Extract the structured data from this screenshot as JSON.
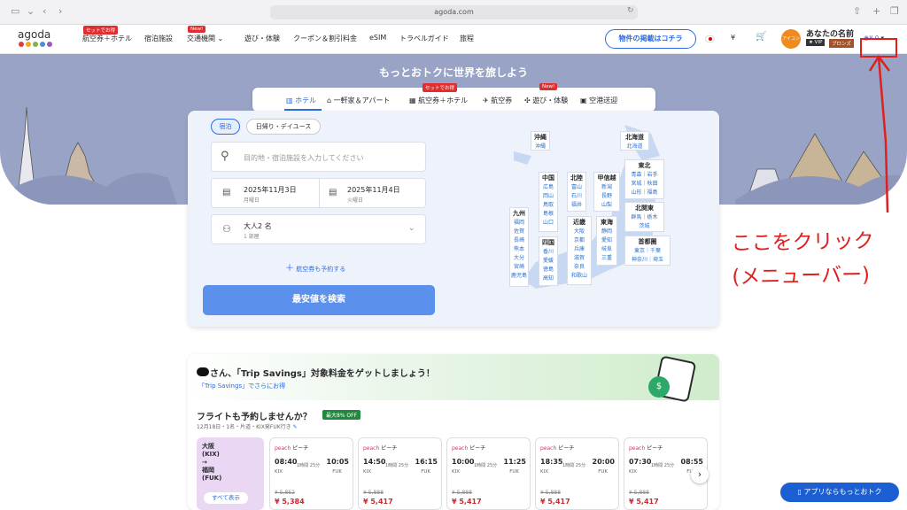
{
  "browser": {
    "url": "agoda.com"
  },
  "nav": {
    "logo": "agoda",
    "items": [
      "航空券＋ホテル",
      "宿泊施設",
      "交通機関",
      "遊び・体験",
      "クーポン＆割引料金",
      "eSIM",
      "トラベルガイド",
      "旅程"
    ],
    "tag_set": "セットでお得",
    "tag_new": "New!",
    "list_property": "物件の掲載はコチラ",
    "currency": "¥",
    "user_name": "あなたの名前",
    "vip": "★ VIP",
    "bronze": "ブロンズ",
    "avatar_text": "アイコン",
    "wallet": "¥ 0"
  },
  "hero": {
    "title": "もっとおトクに世界を旅しよう",
    "tabs": [
      "ホテル",
      "一軒家＆アパート",
      "航空券＋ホテル",
      "航空券",
      "遊び・体験",
      "空港送迎"
    ],
    "tab_tag_set": "セットでお得",
    "tab_tag_new": "New!"
  },
  "search": {
    "mode_stay": "宿泊",
    "mode_day": "日帰り・デイユース",
    "placeholder": "目的地・宿泊施設を入力してください",
    "checkin": "2025年11月3日",
    "checkin_day": "月曜日",
    "checkout": "2025年11月4日",
    "checkout_day": "火曜日",
    "guests": "大人2 名",
    "rooms": "1 部屋",
    "add_flight": "航空券も予約する",
    "search_button": "最安値を検索"
  },
  "map": {
    "regions": [
      {
        "name": "沖縄",
        "items": [
          "沖縄"
        ]
      },
      {
        "name": "北海道",
        "items": [
          "北海道"
        ]
      },
      {
        "name": "中国",
        "items": [
          "広島",
          "岡山",
          "鳥取",
          "島根",
          "山口"
        ]
      },
      {
        "name": "北陸",
        "items": [
          "富山",
          "石川",
          "福井"
        ]
      },
      {
        "name": "甲信越",
        "items": [
          "新潟",
          "長野",
          "山梨"
        ]
      },
      {
        "name": "東北",
        "items": [
          "青森｜岩手",
          "宮城｜秋田",
          "山形｜福島"
        ]
      },
      {
        "name": "九州",
        "items": [
          "福岡",
          "佐賀",
          "長崎",
          "熊本",
          "大分",
          "宮崎",
          "鹿児島"
        ]
      },
      {
        "name": "近畿",
        "items": [
          "大阪",
          "京都",
          "兵庫",
          "滋賀",
          "奈良",
          "和歌山"
        ]
      },
      {
        "name": "東海",
        "items": [
          "静岡",
          "愛知",
          "岐阜",
          "三重"
        ]
      },
      {
        "name": "北関東",
        "items": [
          "群馬｜栃木",
          "茨城"
        ]
      },
      {
        "name": "四国",
        "items": [
          "香川",
          "愛媛",
          "徳島",
          "高知"
        ]
      },
      {
        "name": "首都圏",
        "items": [
          "東京｜千葉",
          "神奈川｜埼玉"
        ]
      }
    ]
  },
  "promo": {
    "headline": "さん、「Trip Savings」対象料金をゲットしましょう！",
    "sub": "「Trip Savings」でさらにお得",
    "flight_title": "フライトも予約しませんか？",
    "badge": "最大8% OFF",
    "meta": "12月18日・1名・片道・KIX発FUK行き",
    "route": [
      "大阪",
      "(KIX)",
      "→",
      "福岡",
      "(FUK)"
    ],
    "show_all": "すべて表示",
    "flights": [
      {
        "airline": "ピーチ",
        "dep": "08:40",
        "arr": "10:05",
        "dur": "1時間 25分",
        "old": "¥ 5,852",
        "price": "¥ 5,384"
      },
      {
        "airline": "ピーチ",
        "dep": "14:50",
        "arr": "16:15",
        "dur": "1時間 25分",
        "old": "¥ 5,888",
        "price": "¥ 5,417"
      },
      {
        "airline": "ピーチ",
        "dep": "10:00",
        "arr": "11:25",
        "dur": "1時間 25分",
        "old": "¥ 5,888",
        "price": "¥ 5,417"
      },
      {
        "airline": "ピーチ",
        "dep": "18:35",
        "arr": "20:00",
        "dur": "1時間 25分",
        "old": "¥ 5,888",
        "price": "¥ 5,417"
      },
      {
        "airline": "ピーチ",
        "dep": "07:30",
        "arr": "08:55",
        "dur": "1時間 25分",
        "old": "¥ 5,888",
        "price": "¥ 5,417"
      }
    ],
    "airline_code": "peach",
    "from": "KIX",
    "to": "FUK"
  },
  "annotation": {
    "line1": "ここをクリック",
    "line2": "(メニューバー)"
  },
  "app_button": "アプリならもっとおトク"
}
